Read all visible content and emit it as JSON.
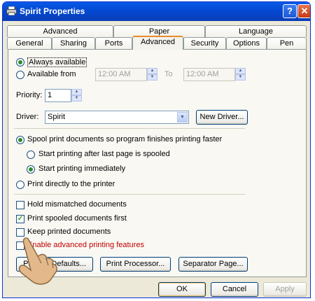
{
  "window": {
    "title": "Spirit Properties",
    "help_label": "?",
    "close_label": "✕"
  },
  "tabs": {
    "row1": [
      {
        "label": "Advanced"
      },
      {
        "label": "Paper"
      },
      {
        "label": "Language"
      }
    ],
    "row2": [
      {
        "label": "General"
      },
      {
        "label": "Sharing"
      },
      {
        "label": "Ports"
      },
      {
        "label": "Advanced"
      },
      {
        "label": "Security"
      },
      {
        "label": "Options"
      },
      {
        "label": "Pen"
      }
    ]
  },
  "availability": {
    "always_label": "Always available",
    "from_label": "Available from",
    "from_time": "12:00 AM",
    "to_label": "To",
    "to_time": "12:00 AM"
  },
  "priority": {
    "label": "Priority:",
    "value": "1"
  },
  "driver": {
    "label": "Driver:",
    "value": "Spirit",
    "new_driver_label": "New Driver..."
  },
  "spool": {
    "spool_label": "Spool print documents so program finishes printing faster",
    "after_last_label": "Start printing after last page is spooled",
    "immediately_label": "Start printing immediately",
    "direct_label": "Print directly to the printer"
  },
  "options": [
    {
      "label": "Hold mismatched documents",
      "checked": false
    },
    {
      "label": "Print spooled documents first",
      "checked": true
    },
    {
      "label": "Keep printed documents",
      "checked": false
    },
    {
      "label": "Enable advanced printing features",
      "checked": false
    }
  ],
  "bottom_buttons": {
    "defaults_label": "Printing Defaults...",
    "processor_label": "Print Processor...",
    "separator_label": "Separator Page..."
  },
  "dialog_buttons": {
    "ok_label": "OK",
    "cancel_label": "Cancel",
    "apply_label": "Apply"
  },
  "colors": {
    "title_bar": "#0348d2",
    "selected_tab_accent": "#e68b2c",
    "highlight_text": "#c00000"
  }
}
